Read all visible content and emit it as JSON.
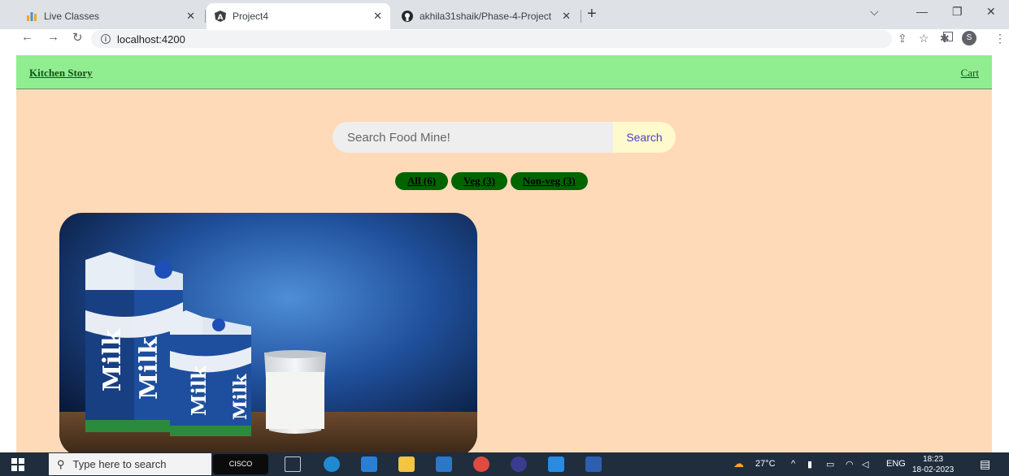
{
  "browser": {
    "tabs": [
      {
        "label": "Live Classes",
        "icon": "live-classes-icon",
        "active": false
      },
      {
        "label": "Project4",
        "icon": "angular-icon",
        "active": true
      },
      {
        "label": "akhila31shaik/Phase-4-Project",
        "icon": "github-icon",
        "active": false
      }
    ],
    "url": "localhost:4200"
  },
  "app": {
    "brand": "Kitchen Story",
    "cart_label": "Cart",
    "search": {
      "placeholder": "Search Food Mine!",
      "button_label": "Search"
    },
    "filters": [
      {
        "label": "All (6)"
      },
      {
        "label": "Veg (3)"
      },
      {
        "label": "Non-veg (3)"
      }
    ],
    "product": {
      "image_text": "Milk"
    }
  },
  "taskbar": {
    "search_placeholder": "Type here to search",
    "cisco_label": "CISCO",
    "weather": "27°C",
    "language": "ENG",
    "time": "18:23",
    "date": "18-02-2023"
  },
  "colors": {
    "navbar": "#90ee90",
    "page_background": "#ffdab9",
    "filter_button": "#006400",
    "search_button": "#fffacd"
  }
}
